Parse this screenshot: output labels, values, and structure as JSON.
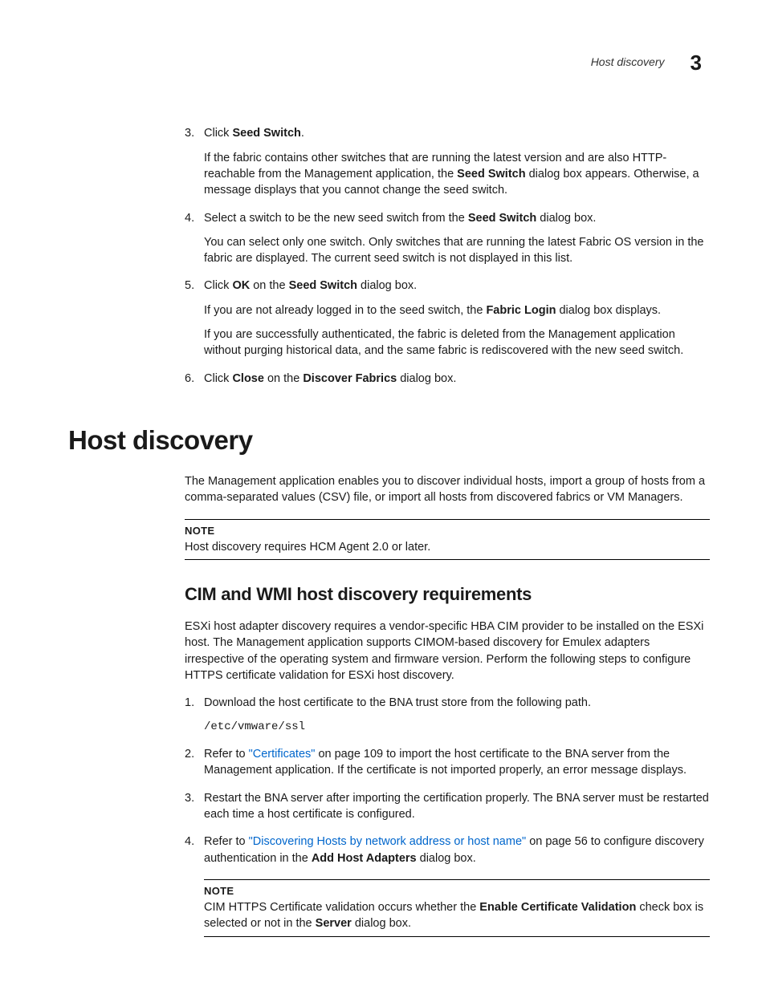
{
  "header": {
    "title": "Host discovery",
    "chapter": "3"
  },
  "step3": {
    "num": "3.",
    "pre": "Click ",
    "bold": "Seed Switch",
    "post": ".",
    "p1_a": "If the fabric contains other switches that are running the latest version and are also HTTP-reachable from the Management application, the ",
    "p1_b": "Seed Switch",
    "p1_c": " dialog box appears. Otherwise, a message displays that you cannot change the seed switch."
  },
  "step4": {
    "num": "4.",
    "a": "Select a switch to be the new seed switch from the ",
    "b": "Seed Switch",
    "c": " dialog box.",
    "p1": "You can select only one switch. Only switches that are running the latest Fabric OS version in the fabric are displayed. The current seed switch is not displayed in this list."
  },
  "step5": {
    "num": "5.",
    "a": "Click ",
    "b": "OK",
    "c": " on the ",
    "d": "Seed Switch",
    "e": " dialog box.",
    "p1_a": "If you are not already logged in to the seed switch, the ",
    "p1_b": "Fabric Login",
    "p1_c": " dialog box displays.",
    "p2": "If you are successfully authenticated, the fabric is deleted from the Management application without purging historical data, and the same fabric is rediscovered with the new seed switch."
  },
  "step6": {
    "num": "6.",
    "a": "Click ",
    "b": "Close",
    "c": " on the ",
    "d": "Discover Fabrics",
    "e": " dialog box."
  },
  "h1": "Host discovery",
  "intro": "The Management application enables you to discover individual hosts, import a group of hosts from a comma-separated values (CSV) file, or import all hosts from discovered fabrics or VM Managers.",
  "note1": {
    "label": "NOTE",
    "text": "Host discovery requires HCM Agent 2.0 or later."
  },
  "h2": "CIM and WMI host discovery requirements",
  "cim_intro": "ESXi host adapter discovery requires a vendor-specific HBA CIM provider to be installed on the ESXi host. The Management application supports CIMOM-based discovery for Emulex adapters irrespective of the operating system and firmware version. Perform the following steps to configure HTTPS certificate validation for ESXi host discovery.",
  "c1": {
    "num": "1.",
    "text": "Download the host certificate to the BNA trust store from the following path.",
    "code": "/etc/vmware/ssl"
  },
  "c2": {
    "num": "2.",
    "a": "Refer to ",
    "link": "\"Certificates\"",
    "b": " on page 109 to import the host certificate to the BNA server from the Management application. If the certificate is not imported properly, an error message displays."
  },
  "c3": {
    "num": "3.",
    "text": "Restart the BNA server after importing the certification properly. The BNA server must be restarted each time a host certificate is configured."
  },
  "c4": {
    "num": "4.",
    "a": "Refer to ",
    "link": "\"Discovering Hosts by network address or host name\"",
    "b": " on page 56 to configure discovery authentication in the ",
    "bold": "Add Host Adapters",
    "c": " dialog box."
  },
  "note2": {
    "label": "NOTE",
    "a": "CIM HTTPS Certificate validation occurs whether the ",
    "b": "Enable Certificate Validation",
    "c": " check box is selected or not in the ",
    "d": "Server",
    "e": " dialog box."
  }
}
